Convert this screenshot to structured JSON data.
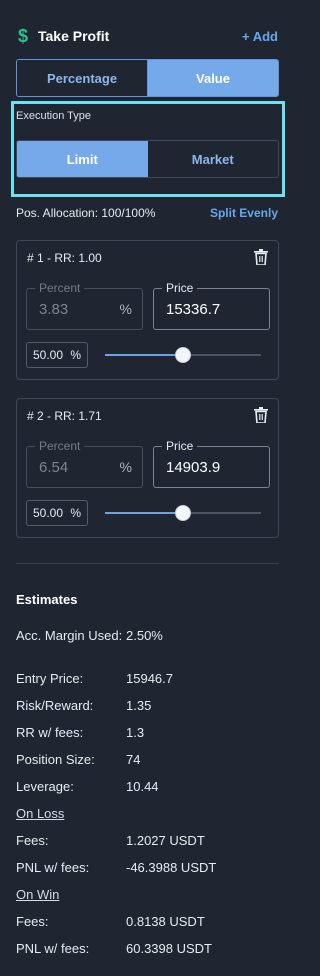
{
  "header": {
    "title": "Take Profit",
    "add_label": "+ Add"
  },
  "mode_toggle": {
    "options": [
      "Percentage",
      "Value"
    ],
    "selected": "Value"
  },
  "execution": {
    "label": "Execution Type",
    "options": [
      "Limit",
      "Market"
    ],
    "selected": "Limit"
  },
  "allocation": {
    "text": "Pos. Allocation: 100/100%",
    "split_label": "Split Evenly"
  },
  "targets": [
    {
      "title": "# 1 - RR: 1.00",
      "percent_legend": "Percent",
      "percent_value": "3.83",
      "percent_unit": "%",
      "price_legend": "Price",
      "price_value": "15336.7",
      "alloc_value": "50.00",
      "alloc_unit": "%",
      "slider_fraction": 0.5
    },
    {
      "title": "# 2 - RR: 1.71",
      "percent_legend": "Percent",
      "percent_value": "6.54",
      "percent_unit": "%",
      "price_legend": "Price",
      "price_value": "14903.9",
      "alloc_value": "50.00",
      "alloc_unit": "%",
      "slider_fraction": 0.5
    }
  ],
  "estimates": {
    "title": "Estimates",
    "rows": [
      {
        "label": "Acc. Margin Used:",
        "value": "2.50%"
      },
      {
        "label": "Entry Price:",
        "value": "15946.7"
      },
      {
        "label": "Risk/Reward:",
        "value": "1.35"
      },
      {
        "label": "RR w/ fees:",
        "value": "1.3"
      },
      {
        "label": "Position Size:",
        "value": "74"
      },
      {
        "label": "Leverage:",
        "value": "10.44"
      }
    ],
    "on_loss": {
      "label": "On Loss",
      "fees_label": "Fees:",
      "fees_value": "1.2027 USDT",
      "pnl_label": "PNL w/ fees:",
      "pnl_value": "-46.3988 USDT"
    },
    "on_win": {
      "label": "On Win",
      "fees_label": "Fees:",
      "fees_value": "0.8138 USDT",
      "pnl_label": "PNL w/ fees:",
      "pnl_value": "60.3398 USDT"
    }
  },
  "colors": {
    "background": "#1f2631",
    "accent": "#76a9ea",
    "profit_icon": "#2fc08b",
    "highlight_border": "#6ee0ee"
  },
  "icons": {
    "title_icon": "dollar-icon",
    "delete_icon": "trash-icon"
  }
}
